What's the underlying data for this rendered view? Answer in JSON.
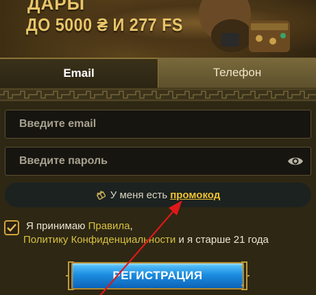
{
  "hero": {
    "line1": "ДАРЫ",
    "line2": "ДО 5000 ₴ И 277 FS"
  },
  "tabs": [
    {
      "label": "Email",
      "active": true
    },
    {
      "label": "Телефон",
      "active": false
    }
  ],
  "form": {
    "email_placeholder": "Введите email",
    "password_placeholder": "Введите пароль",
    "eye_icon": "eye-icon"
  },
  "promo": {
    "text": "У меня есть",
    "link": "промокод",
    "icon": "gift-icon"
  },
  "terms": {
    "checked": true,
    "prefix": "Я принимаю",
    "rules_link": "Правила",
    "comma": ",",
    "privacy_link": "Политику Конфиденциальности",
    "suffix": "и я старше 21 года"
  },
  "register_button": "РЕГИСТРАЦИЯ",
  "colors": {
    "accent_gold": "#f2c230",
    "link_yellow": "#d8c040",
    "button_blue": "#1d8de0",
    "arrow_red": "#e01818"
  }
}
